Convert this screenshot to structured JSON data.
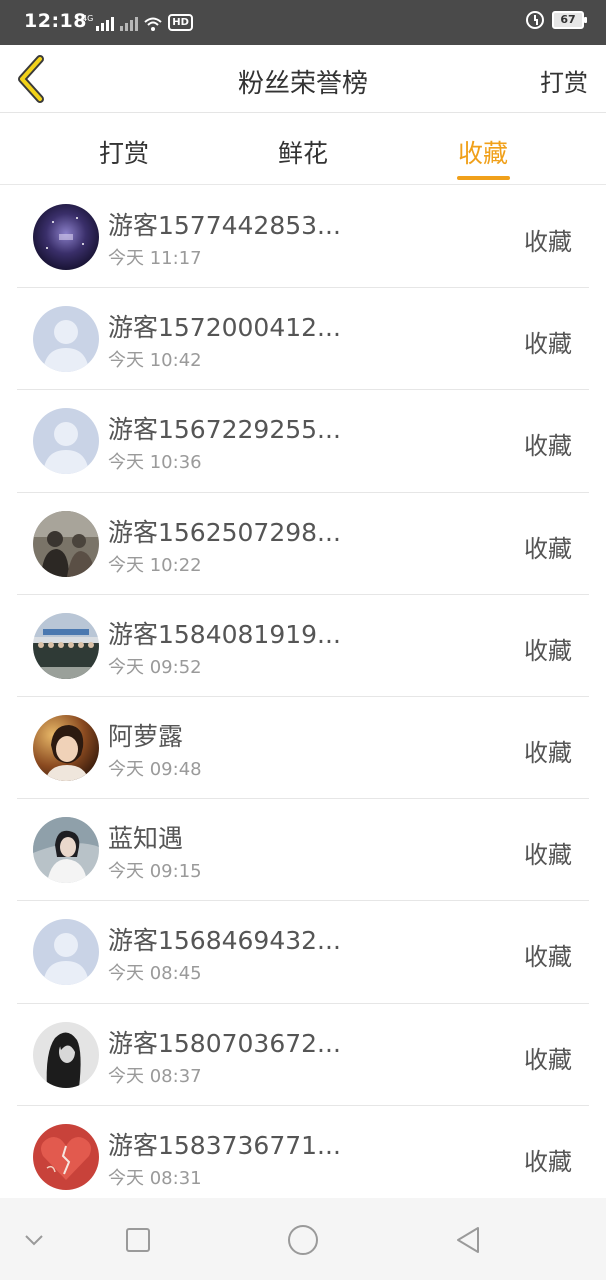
{
  "status": {
    "time": "12:18",
    "net_label": "4G",
    "hd_label": "HD",
    "battery": "67"
  },
  "header": {
    "title": "粉丝荣誉榜",
    "action": "打赏"
  },
  "tabs": [
    {
      "label": "打赏",
      "active": false
    },
    {
      "label": "鲜花",
      "active": false
    },
    {
      "label": "收藏",
      "active": true
    }
  ],
  "colors": {
    "accent": "#f0a01a",
    "status_bar": "#4a4a4a"
  },
  "list": [
    {
      "name": "游客1577442853...",
      "time": "今天 11:17",
      "type": "收藏",
      "avatar": "galaxy-avatar"
    },
    {
      "name": "游客1572000412...",
      "time": "今天 10:42",
      "type": "收藏",
      "avatar": "default-avatar"
    },
    {
      "name": "游客1567229255...",
      "time": "今天 10:36",
      "type": "收藏",
      "avatar": "default-avatar"
    },
    {
      "name": "游客1562507298...",
      "time": "今天 10:22",
      "type": "收藏",
      "avatar": "photo-avatar"
    },
    {
      "name": "游客1584081919...",
      "time": "今天 09:52",
      "type": "收藏",
      "avatar": "group-photo-avatar"
    },
    {
      "name": "阿萝露",
      "time": "今天 09:48",
      "type": "收藏",
      "avatar": "portrait-avatar"
    },
    {
      "name": "蓝知遇",
      "time": "今天 09:15",
      "type": "收藏",
      "avatar": "portrait-avatar"
    },
    {
      "name": "游客1568469432...",
      "time": "今天 08:45",
      "type": "收藏",
      "avatar": "default-avatar"
    },
    {
      "name": "游客1580703672...",
      "time": "今天 08:37",
      "type": "收藏",
      "avatar": "bw-portrait-avatar"
    },
    {
      "name": "游客1583736771...",
      "time": "今天 08:31",
      "type": "收藏",
      "avatar": "heart-avatar"
    }
  ]
}
